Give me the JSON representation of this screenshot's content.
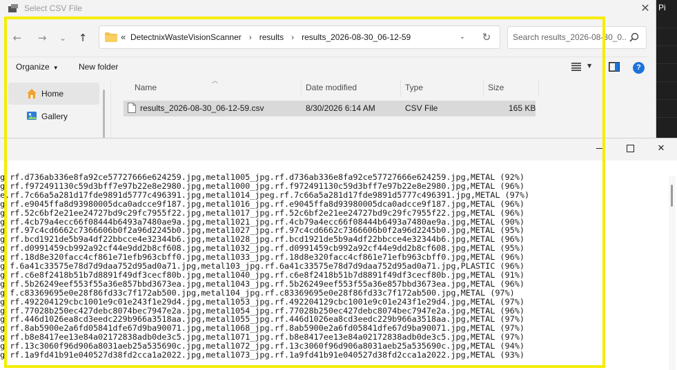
{
  "background_window": {
    "title_fragment": "Pi"
  },
  "dialog": {
    "title": "Select CSV File",
    "close_glyph": "✕",
    "nav": {
      "back_glyph": "←",
      "forward_glyph": "→",
      "recent_glyph": "⌄",
      "up_glyph": "↑"
    },
    "address": {
      "lead": "«",
      "crumbs": [
        "DetectnixWasteVisionScanner",
        "results",
        "results_2026-08-30_06-12-59"
      ],
      "separator": "›",
      "dropdown_glyph": "⌄",
      "refresh_glyph": "↻"
    },
    "search": {
      "placeholder": "Search results_2026-08-30_0..."
    },
    "commands": {
      "organize": "Organize",
      "new_folder": "New folder",
      "help_glyph": "?"
    },
    "navpane": {
      "home": "Home",
      "gallery": "Gallery"
    },
    "columns": {
      "name": "Name",
      "date_modified": "Date modified",
      "type": "Type",
      "size": "Size"
    },
    "file": {
      "name": "results_2026-08-30_06-12-59.csv",
      "date_modified": "8/30/2026 6:14 AM",
      "type": "CSV File",
      "size": "165 KB"
    }
  },
  "text_window": {
    "lines": [
      "g rf.d736ab336e8fa92ce57727666e624259.jpg,metal1005_jpg.rf.d736ab336e8fa92ce57727666e624259.jpg,METAL (92%)",
      "g rf.f972491130c59d3bff7e97b22e8e2980.jpg,metal1000_jpg.rf.f972491130c59d3bff7e97b22e8e2980.jpg,METAL (96%)",
      "e.rf.7c66a5a281d17fde9891d5777c496391.jpg,metal1014_jpeg.rf.7c66a5a281d17fde9891d5777c496391.jpg,METAL (97%)",
      "g rf.e9045ffa8d93980005dca0adcce9f187.jpg,metal1016_jpg.rf.e9045ffa8d93980005dca0adcce9f187.jpg,METAL (96%)",
      "g rf.52c6bf2e21ee24727bd9c29fc7955f22.jpg,metal1017_jpg.rf.52c6bf2e21ee24727bd9c29fc7955f22.jpg,METAL (96%)",
      "g rf.4cb79a4ecc66f08444b6493a7480ae9a.jpg,metal1021_jpg.rf.4cb79a4ecc66f08444b6493a7480ae9a.jpg,METAL (90%)",
      "g rf.97c4cd6662c7366606b0f2a96d2245b0.jpg,metal1027_jpg.rf.97c4cd6662c7366606b0f2a96d2245b0.jpg,METAL (95%)",
      "g rf.bcd1921de5b9a4df22bbcce4e32344b6.jpg,metal1028_jpg.rf.bcd1921de5b9a4df22bbcce4e32344b6.jpg,METAL (96%)",
      "g rf.d0991459cb992a92cf44e9dd2b8cf608.jpg,metal1032_jpg.rf.d0991459cb992a92cf44e9dd2b8cf608.jpg,METAL (95%)",
      "g rf.18d8e320facc4cf861e71efb963cbff0.jpg,metal1033_jpg.rf.18d8e320facc4cf861e71efb963cbff0.jpg,METAL (96%)",
      "g f.6a41c33575e78d7d9daa752d95ad0a71.jpg,metal103_jpg.rf.6a41c33575e78d7d9daa752d95ad0a71.jpg,PLASTIC (96%)",
      "g rf.c6e8f2418b51b7d8891f49df3cecf80b.jpg,metal1040_jpg.rf.c6e8f2418b51b7d8891f49df3cecf80b.jpg,METAL (91%)",
      "g rf.5b26249eef553f55a36e857bbd3673ea.jpg,metal1043_jpg.rf.5b26249eef553f55a36e857bbd3673ea.jpg,METAL (96%)",
      "g f.c83369695e0e28f86fd33c7f172ab500.jpg,metal104_jpg.rf.c83369695e0e28f86fd33c7f172ab500.jpg,METAL (97%)",
      "g rf.492204129cbc1001e9c01e243f1e29d4.jpg,metal1053_jpg.rf.492204129cbc1001e9c01e243f1e29d4.jpg,METAL (97%)",
      "g rf.77028b250ec427debc8074bec7947e2a.jpg,metal1054_jpg.rf.77028b250ec427debc8074bec7947e2a.jpg,METAL (96%)",
      "g rf.446d1026ea8cd3eedc229b966a3518aa.jpg,metal1055_jpg.rf.446d1026ea8cd3eedc229b966a3518aa.jpg,METAL (97%)",
      "g rf.8ab5900e2a6fd05841dfe67d9ba90071.jpg,metal1068_jpg.rf.8ab5900e2a6fd05841dfe67d9ba90071.jpg,METAL (97%)",
      "g rf.b8e8417ee13e84a02172838adb0de3c5.jpg,metal1071_jpg.rf.b8e8417ee13e84a02172838adb0de3c5.jpg,METAL (97%)",
      "g rf.13c3060f96d906a8031aeb25a535690c.jpg,metal1072_jpg.rf.13c3060f96d906a8031aeb25a535690c.jpg,METAL (94%)",
      "g rf.1a9fd41b91e040527d38fd2cca1a2022.jpg,metal1073_jpg.rf.1a9fd41b91e040527d38fd2cca1a2022.jpg,METAL (93%)"
    ]
  },
  "colors": {
    "highlight": "#f5ec00",
    "folder": "#f2c14e",
    "accent": "#1b73d9"
  }
}
